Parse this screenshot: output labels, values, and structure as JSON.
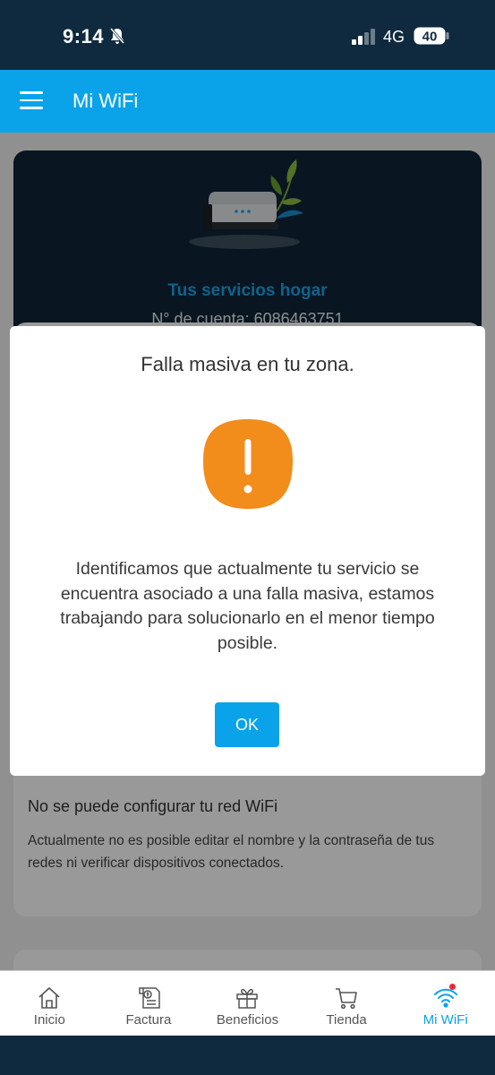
{
  "status_bar": {
    "time": "9:14",
    "network": "4G",
    "battery": "40"
  },
  "header": {
    "title": "Mi WiFi"
  },
  "hero": {
    "title": "Tus servicios hogar",
    "account": "N° de cuenta: 6086463751"
  },
  "info_card": {
    "title": "No se puede configurar tu red WiFi",
    "text": "Actualmente no es posible editar el nombre y la contraseña de tus redes ni verificar dispositivos conectados."
  },
  "modal": {
    "title": "Falla masiva en tu zona.",
    "message": "Identificamos que actualmente tu servicio se encuentra asociado a una falla masiva, estamos trabajando para solucionarlo en el menor tiempo posible.",
    "ok_label": "OK"
  },
  "nav": {
    "items": [
      {
        "label": "Inicio",
        "icon": "home-icon"
      },
      {
        "label": "Factura",
        "icon": "invoice-icon"
      },
      {
        "label": "Beneficios",
        "icon": "gift-icon"
      },
      {
        "label": "Tienda",
        "icon": "cart-icon"
      },
      {
        "label": "Mi WiFi",
        "icon": "wifi-icon"
      }
    ],
    "active": "Mi WiFi"
  },
  "colors": {
    "brand": "#0aa3ea",
    "warning": "#f28c1a",
    "dark": "#0f2637",
    "notification": "#e62a3a"
  }
}
